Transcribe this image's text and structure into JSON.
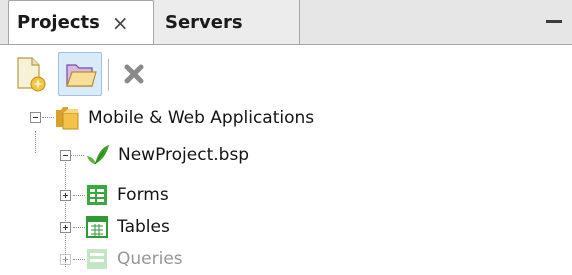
{
  "tabs": [
    {
      "label": "Projects",
      "close": "×",
      "active": true
    },
    {
      "label": "Servers",
      "active": false
    }
  ],
  "toolbar": {
    "buttons": [
      "new-project-icon",
      "open-project-icon",
      "delete-icon"
    ]
  },
  "tree": {
    "root": {
      "label": "Mobile & Web Applications",
      "icon": "folder-icon",
      "expanded": true
    },
    "project": {
      "label": "NewProject.bsp",
      "icon": "project-leaf-icon",
      "expanded": true
    },
    "children": [
      {
        "label": "Forms",
        "icon": "forms-icon",
        "expanded": false
      },
      {
        "label": "Tables",
        "icon": "tables-icon",
        "expanded": false
      },
      {
        "label": "Queries",
        "icon": "queries-icon",
        "expanded": false
      }
    ]
  },
  "colors": {
    "tab_bar": "#e6e6e6",
    "selected_button": "#dbeaf8",
    "folder": "#f0b93a",
    "leaf": "#4aa42e",
    "grid_icon": "#2f9a36"
  }
}
